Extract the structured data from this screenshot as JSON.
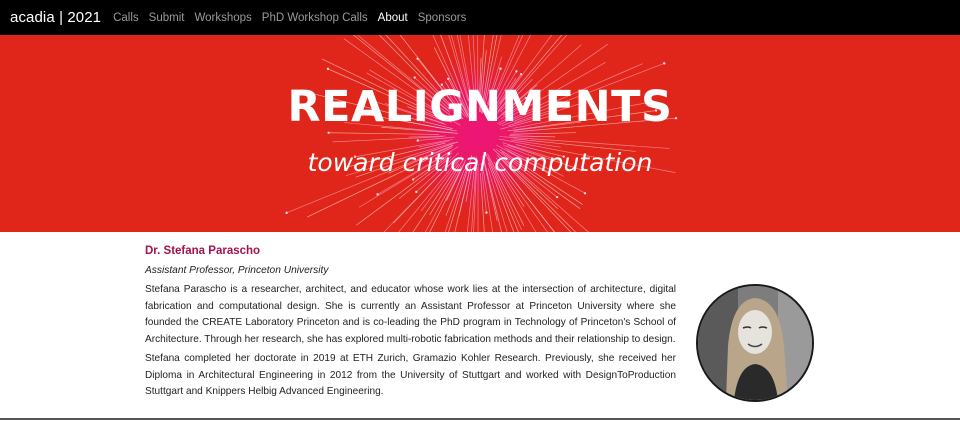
{
  "nav": {
    "brand": "acadia | 2021",
    "links": [
      "Calls",
      "Submit",
      "Workshops",
      "PhD Workshop Calls",
      "About",
      "Sponsors"
    ],
    "active": "About"
  },
  "hero": {
    "title": "REALIGNMENTS",
    "subtitle": "toward critical computation"
  },
  "colors": {
    "hero_bg": "#e0261a",
    "burst": "#e8176b",
    "name_accent": "#a5114d"
  },
  "person": {
    "name": "Dr. Stefana Parascho",
    "role": "Assistant Professor, Princeton University",
    "bio": [
      "Stefana Parascho is a researcher, architect, and educator whose work lies at the intersection of architecture, digital fabrication and computational design. She is currently an Assistant Professor at Princeton University where she founded the CREATE Laboratory Princeton and is co-leading the PhD program in Technology of Princeton's School of Architecture. Through her research, she has explored multi-robotic fabrication methods and their relationship to design.",
      "Stefana completed her doctorate in 2019 at ETH Zurich, Gramazio Kohler Research. Previously, she received her Diploma in Architectural Engineering in 2012 from the University of Stuttgart and worked with DesignToProduction Stuttgart and Knippers Helbig Advanced Engineering."
    ]
  }
}
